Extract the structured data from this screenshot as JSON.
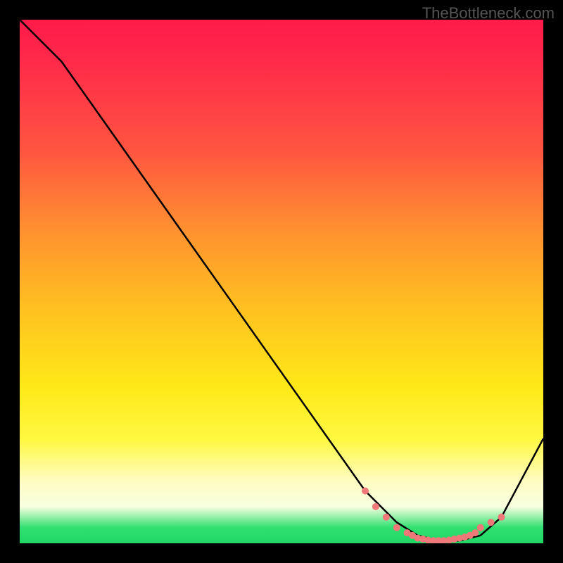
{
  "attribution": "TheBottleneck.com",
  "chart_data": {
    "type": "line",
    "title": "",
    "xlabel": "",
    "ylabel": "",
    "xlim": [
      0,
      100
    ],
    "ylim": [
      0,
      100
    ],
    "series": [
      {
        "name": "curve",
        "x": [
          0,
          8,
          66,
          72,
          76,
          80,
          84,
          88,
          92,
          100
        ],
        "values": [
          100,
          92,
          10,
          4,
          1.5,
          0.5,
          0.5,
          1.5,
          5,
          20
        ]
      }
    ],
    "markers": {
      "name": "highlight-points",
      "color": "#f07878",
      "x": [
        66,
        68,
        70,
        72,
        74,
        75,
        76,
        77,
        78,
        79,
        80,
        81,
        82,
        83,
        84,
        85,
        86,
        87,
        88,
        90,
        92
      ],
      "values": [
        10,
        7,
        5,
        3,
        2,
        1.5,
        1,
        0.8,
        0.6,
        0.5,
        0.5,
        0.5,
        0.6,
        0.8,
        1,
        1.2,
        1.5,
        2,
        3,
        4,
        5
      ]
    },
    "gradient_stops": [
      {
        "pos": 0,
        "color": "#ff1a4a"
      },
      {
        "pos": 25,
        "color": "#ff5540"
      },
      {
        "pos": 55,
        "color": "#ffc020"
      },
      {
        "pos": 80,
        "color": "#fff840"
      },
      {
        "pos": 97,
        "color": "#30e070"
      }
    ]
  }
}
